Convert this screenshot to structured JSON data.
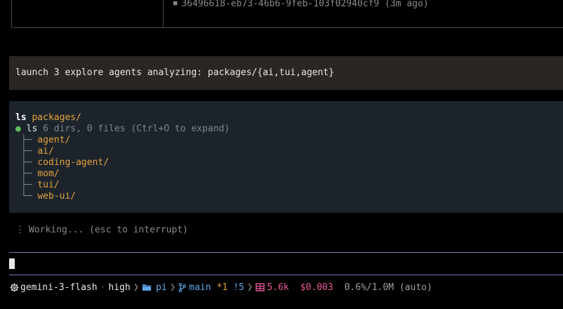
{
  "session_list": {
    "entry": "36496618-eb73-46b6-9feb-103f02940cf9",
    "entry_age": "(3m ago)"
  },
  "prompt": {
    "text": "launch 3 explore agents analyzing: packages/{ai,tui,agent}"
  },
  "tool_call": {
    "command": "ls",
    "arg": "packages/",
    "result_cmd": "ls",
    "result_summary": "6 dirs, 0 files (Ctrl+O to expand)",
    "entries": [
      "agent/",
      "ai/",
      "coding-agent/",
      "mom/",
      "tui/",
      "web-ui/"
    ]
  },
  "working": {
    "spinner": "⋮",
    "text": "Working... (esc to interrupt)"
  },
  "status_bar": {
    "model": "gemini-3-flash",
    "separator": "·",
    "thinking_level": "high",
    "directory": "pi",
    "branch": "main",
    "dirty": "*1",
    "ahead": "!5",
    "tokens": "5.6k",
    "cost": "$0.003",
    "context": "0.6%/1.0M (auto)"
  },
  "colors": {
    "background": "#000000",
    "prompt_bg": "#2a2623",
    "tool_bg": "#1c232b",
    "accent_orange": "#e3a33d",
    "accent_blue": "#5fa8e8",
    "accent_pink": "#e85a9a",
    "success_green": "#5fbf5f",
    "input_border": "#7a78b8"
  },
  "icons": {
    "model": "gear-icon",
    "folder": "folder-icon",
    "branch": "git-branch-icon",
    "tokens": "grid-icon"
  }
}
